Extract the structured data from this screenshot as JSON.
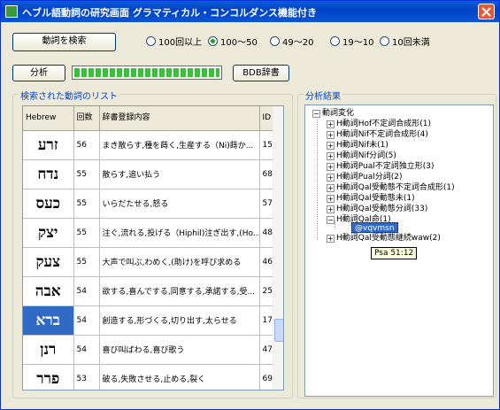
{
  "window": {
    "title": "ヘブル語動詞の研究画面  グラマティカル・コンコルダンス機能付き"
  },
  "toolbar": {
    "search_label": "動詞を検索",
    "analyze_label": "分析",
    "bdb_label": "BDB辞書",
    "progress_pct": 100
  },
  "frequency": {
    "options": [
      "100回以上",
      "100〜50",
      "49〜20",
      "19〜10",
      "10回未満"
    ],
    "selected": "100〜50"
  },
  "list": {
    "legend": "検索された動詞のリスト",
    "columns": [
      "Hebrew",
      "回数",
      "辞書登録内容",
      "ID"
    ],
    "rows": [
      {
        "hebrew": "זרע",
        "count": "56",
        "desc": "まき散らす,種を蒔く,生産する（Ni)蒔か...",
        "id": "15"
      },
      {
        "hebrew": "נדח",
        "count": "55",
        "desc": "散らす,追い払う",
        "id": "68"
      },
      {
        "hebrew": "כעס",
        "count": "55",
        "desc": "いらだたせる,怒る",
        "id": "57"
      },
      {
        "hebrew": "יצק",
        "count": "55",
        "desc": "注ぐ,流れる,投げる（Hiphil)注ぎ出す,(Ho...",
        "id": "48"
      },
      {
        "hebrew": "צעק",
        "count": "55",
        "desc": "大声で叫ぶ,わめく,(助け)を呼び求める",
        "id": "46"
      },
      {
        "hebrew": "אבה",
        "count": "54",
        "desc": "欲する,喜んでする,同意する,承諾する,受...",
        "id": "25"
      },
      {
        "hebrew": "ברא",
        "count": "54",
        "desc": "創造する,形づくる,切り出す,太らせる",
        "id": "17"
      },
      {
        "hebrew": "רנן",
        "count": "54",
        "desc": "喜び叫ばわる,喜び歌う",
        "id": "47"
      },
      {
        "hebrew": "פרר",
        "count": "53",
        "desc": "破る,失敗させる,止める,裂く",
        "id": "69"
      }
    ]
  },
  "analysis": {
    "legend": "分析結果",
    "root": "動詞変化",
    "items": [
      "H動詞Hof不定詞合成形(1)",
      "H動詞Nif不定詞合成形(4)",
      "H動詞Nif未(1)",
      "H動詞Nif分詞(5)",
      "H動詞Pual不定詞独立形(3)",
      "H動詞Pual分詞(2)",
      "H動詞Qal受動態不定詞合成形(1)",
      "H動詞Qal受動態未(1)",
      "H動詞Qal受動態分詞(33)",
      "H動詞Qal命(1)",
      "H動詞Qal受動態継続waw(2)"
    ],
    "selected_child": "@vqvmsn",
    "tooltip": "Psa 51:12"
  }
}
